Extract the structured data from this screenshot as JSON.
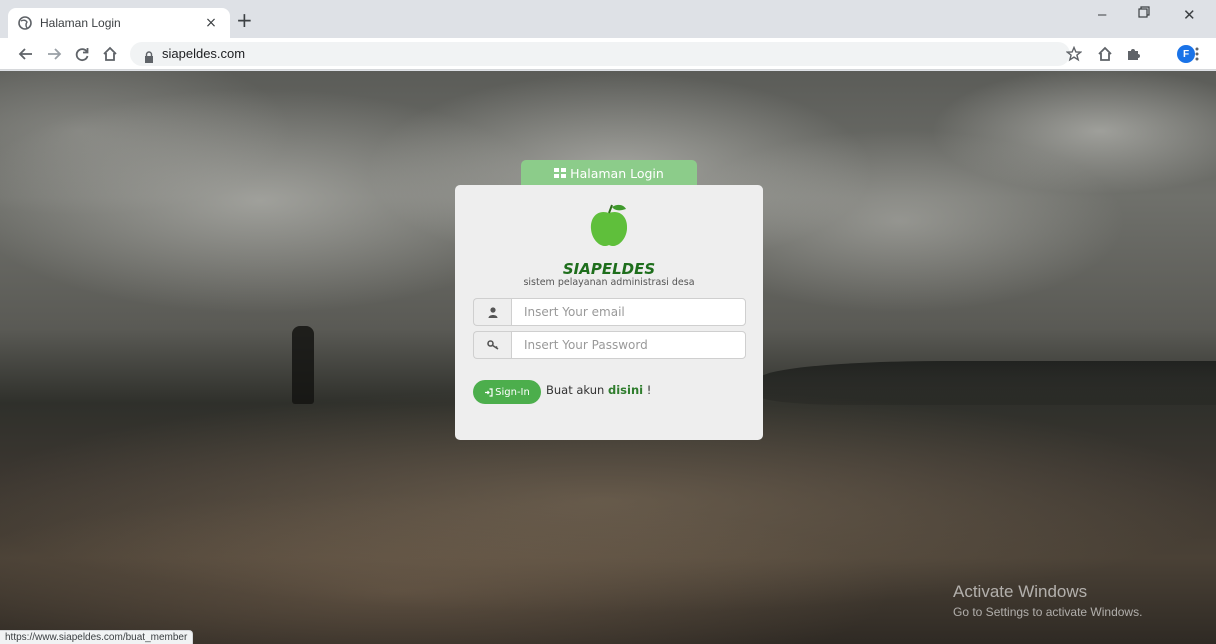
{
  "browser": {
    "tab_title": "Halaman Login",
    "tab_close": "×",
    "new_tab": "+",
    "url": "siapeldes.com",
    "profile_initial": "F",
    "window_controls": {
      "minimize": "–",
      "restore": "🗗",
      "close": "✕"
    },
    "status_url": "https://www.siapeldes.com/buat_member"
  },
  "login": {
    "tab_label": "Halaman Login",
    "app_name": "SIAPELDES",
    "app_subtitle": "sistem pelayanan administrasi desa",
    "email_placeholder": "Insert Your email",
    "password_placeholder": "Insert Your Password",
    "signin_label": "Sign-In",
    "register_prefix": "Buat akun ",
    "register_link": "disini",
    "register_suffix": " !"
  },
  "watermark": {
    "title": "Activate Windows",
    "subtitle": "Go to Settings to activate Windows."
  },
  "colors": {
    "accent_green": "#4cae4c",
    "tab_green": "#8ccc8a",
    "brand_dark_green": "#1e6e1c",
    "avatar_blue": "#1a73e8"
  },
  "icons": [
    "globe-icon",
    "back-icon",
    "forward-icon",
    "reload-icon",
    "home-icon",
    "lock-icon",
    "star-icon",
    "extensions-icon",
    "menu-icon",
    "grid-icon",
    "user-icon",
    "key-icon",
    "sign-in-icon"
  ]
}
